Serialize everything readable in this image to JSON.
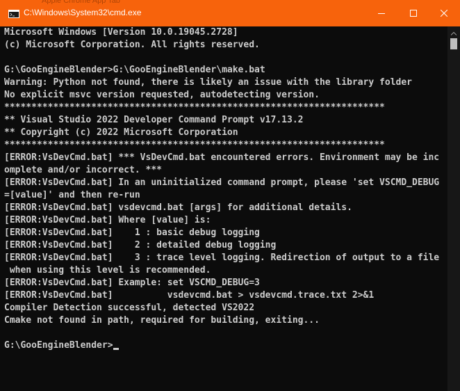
{
  "window": {
    "title": "C:\\Windows\\System32\\cmd.exe",
    "background_tabs_text": "Apple Chrome   App Tab",
    "accent_color": "#f7630c",
    "console_bg": "#0c0c0c",
    "console_fg": "#cccccc"
  },
  "controls": {
    "minimize_icon": "minimize-icon",
    "maximize_icon": "maximize-icon",
    "close_icon": "close-icon"
  },
  "console": {
    "lines": [
      "Microsoft Windows [Version 10.0.19045.2728]",
      "(c) Microsoft Corporation. All rights reserved.",
      "",
      "G:\\GooEngineBlender>G:\\GooEngineBlender\\make.bat",
      "Warning: Python not found, there is likely an issue with the library folder",
      "No explicit msvc version requested, autodetecting version.",
      "**********************************************************************",
      "** Visual Studio 2022 Developer Command Prompt v17.13.2",
      "** Copyright (c) 2022 Microsoft Corporation",
      "**********************************************************************",
      "[ERROR:VsDevCmd.bat] *** VsDevCmd.bat encountered errors. Environment may be inc",
      "omplete and/or incorrect. ***",
      "[ERROR:VsDevCmd.bat] In an uninitialized command prompt, please 'set VSCMD_DEBUG",
      "=[value]' and then re-run",
      "[ERROR:VsDevCmd.bat] vsdevcmd.bat [args] for additional details.",
      "[ERROR:VsDevCmd.bat] Where [value] is:",
      "[ERROR:VsDevCmd.bat]    1 : basic debug logging",
      "[ERROR:VsDevCmd.bat]    2 : detailed debug logging",
      "[ERROR:VsDevCmd.bat]    3 : trace level logging. Redirection of output to a file",
      " when using this level is recommended.",
      "[ERROR:VsDevCmd.bat] Example: set VSCMD_DEBUG=3",
      "[ERROR:VsDevCmd.bat]          vsdevcmd.bat > vsdevcmd.trace.txt 2>&1",
      "Compiler Detection successful, detected VS2022",
      "Cmake not found in path, required for building, exiting...",
      ""
    ],
    "prompt": "G:\\GooEngineBlender>"
  }
}
